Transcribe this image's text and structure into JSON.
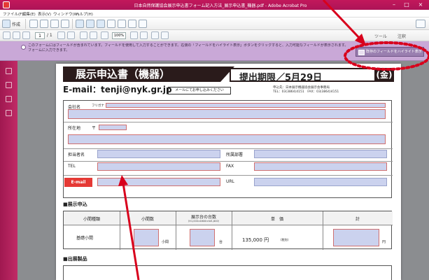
{
  "window": {
    "title": "日本自然保護協会展示申込書フォーム記入方法_展示申込書_機器.pdf - Adobe Acrobat Pro",
    "accent": "#c2185b",
    "controls": {
      "minimize": "–",
      "maximize": "□",
      "close": "×"
    }
  },
  "menubar": {
    "items": [
      "ファイル(F)",
      "編集(E)",
      "表示(V)",
      "ウィンドウ(W)",
      "ヘルプ(H)"
    ]
  },
  "toolbar1": {
    "create_label": "作成",
    "icons": [
      "open-icon",
      "save-icon",
      "print-icon",
      "email-icon",
      "settings-icon",
      "comment-icon",
      "share-icon"
    ]
  },
  "toolbar2": {
    "page_current": "1",
    "page_total": "/ 1",
    "zoom": "100%",
    "tools_label": "ツール",
    "comment_label": "注釈"
  },
  "notification": {
    "text_line1": "このフォームにはフィールドが含まれています。フィールドを使用して入力することができます。右側の「フィールドをハイライト表示」ボタンをクリックすると、入力可能なフィールドが表示されます。",
    "text_line2": "フォームに入力できます。",
    "highlight_button": "既存のフィールドをハイライト表示"
  },
  "document": {
    "banner_title": "展示申込書（機器）",
    "deadline": "提出期限／5月29日",
    "deadline_day": "(金)",
    "email_line": "E-mail：tenji@nyk.gr.jp",
    "email_button": "メールにてお申し込みください",
    "contact_line1": "申込先：日本展示機器協会展示会事務局",
    "contact_line2": "TEL：03(3864)4151　FAX：03(3864)4151",
    "form": {
      "company_label": "会社名",
      "furigana_label": "フリガナ",
      "address_label": "所在地",
      "postal_mark": "〒",
      "person_label": "担当者名",
      "dept_label": "所属部署",
      "tel_label": "TEL",
      "fax_label": "FAX",
      "email_label": "E-mail",
      "url_label": "URL"
    },
    "section_apply": "■展示申込",
    "table": {
      "col1": "小間種類",
      "col2": "小間数",
      "col3": "展示台の台数",
      "col3_sub": "（H1,000×D600×W1,800）",
      "col4": "単　価",
      "col5": "計",
      "row_label": "基礎小間",
      "unit1": "小間",
      "unit2": "台",
      "price": "135,000 円",
      "price_note": "(税別)",
      "unit3": "円"
    },
    "section_products": "■出展製品"
  }
}
